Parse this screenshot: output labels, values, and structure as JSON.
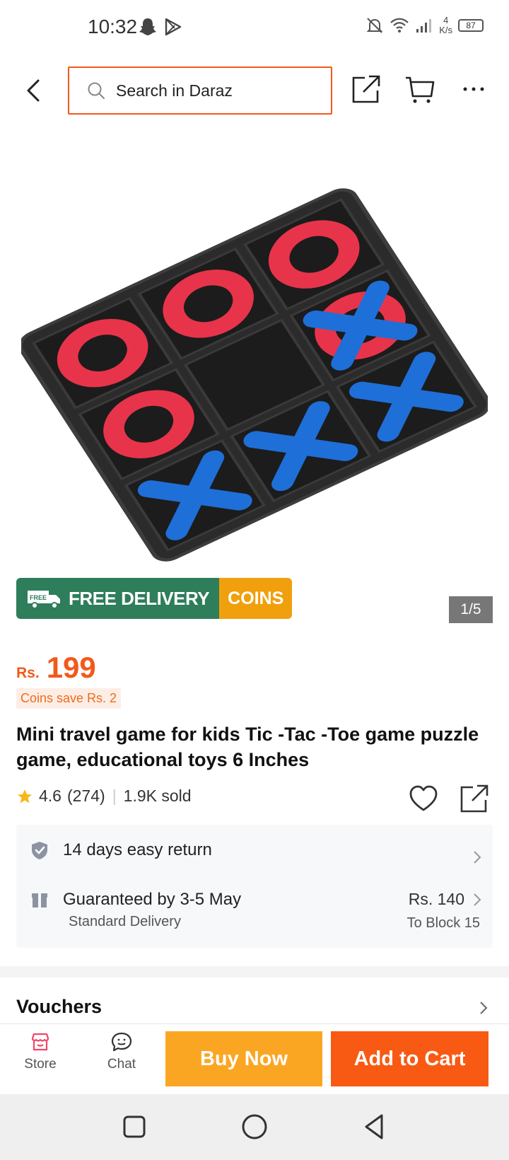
{
  "status_bar": {
    "time": "10:32",
    "net_speed_value": "4",
    "net_speed_unit": "K/s",
    "battery": "87"
  },
  "header": {
    "search_placeholder": "Search in Daraz"
  },
  "promo": {
    "free_badge": "FREE",
    "free_delivery": "FREE DELIVERY",
    "coins": "COINS"
  },
  "gallery": {
    "counter": "1/5"
  },
  "price": {
    "currency": "Rs.",
    "value": "199",
    "coins_save": "Coins save Rs. 2"
  },
  "product": {
    "title": "Mini travel game for kids Tic -Tac -Toe game puzzle game, educational toys 6 Inches",
    "rating": "4.6",
    "reviews": "(274)",
    "sold": "1.9K sold"
  },
  "delivery": {
    "returns": "14 days easy return",
    "guarantee": "Guaranteed by 3-5 May",
    "method": "Standard Delivery",
    "fee": "Rs. 140",
    "destination": "To Block 15"
  },
  "vouchers": {
    "label": "Vouchers"
  },
  "bottom_bar": {
    "store": "Store",
    "chat": "Chat",
    "buy_now": "Buy Now",
    "add_to_cart": "Add to Cart"
  },
  "colors": {
    "brand_orange": "#f85a14",
    "buy_now": "#fba623",
    "free_delivery_green": "#2e7d5b",
    "coins_amber": "#f0a00c"
  }
}
